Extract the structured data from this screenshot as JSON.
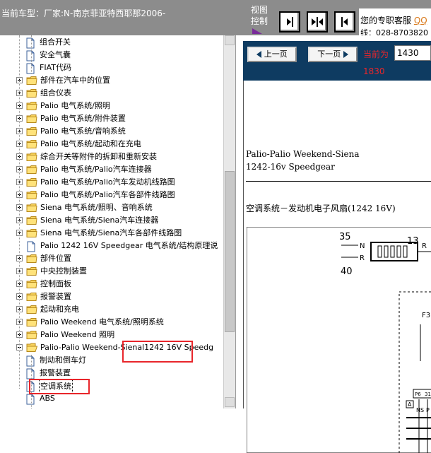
{
  "header": {
    "vehicle_label": "当前车型：厂家:N-南京菲亚特西耶那2006-",
    "view_control_label": "视图控制",
    "support": {
      "label": "您的专职客服",
      "link": "QQ",
      "phone": "线：028-8703820"
    },
    "view_buttons": [
      "collapse-left-icon",
      "split-view-icon",
      "collapse-right-icon"
    ]
  },
  "tree": {
    "items": [
      {
        "label": "组合开关",
        "type": "doc",
        "level": 1,
        "expander": "none"
      },
      {
        "label": "安全气囊",
        "type": "doc",
        "level": 1,
        "expander": "none"
      },
      {
        "label": "FIAT代码",
        "type": "doc",
        "level": 1,
        "expander": "none"
      },
      {
        "label": "部件在汽车中的位置",
        "type": "folder",
        "level": 0,
        "expander": "plus"
      },
      {
        "label": "组合仪表",
        "type": "folder",
        "level": 0,
        "expander": "plus"
      },
      {
        "label": "Palio 电气系统/照明",
        "type": "folder",
        "level": 0,
        "expander": "plus"
      },
      {
        "label": "Palio 电气系统/附件装置",
        "type": "folder",
        "level": 0,
        "expander": "plus"
      },
      {
        "label": "Palio 电气系统/音响系统",
        "type": "folder",
        "level": 0,
        "expander": "plus"
      },
      {
        "label": "Palio 电气系统/起动和在充电",
        "type": "folder",
        "level": 0,
        "expander": "plus"
      },
      {
        "label": "综合开关等附件的拆卸和重新安装",
        "type": "folder",
        "level": 0,
        "expander": "plus"
      },
      {
        "label": "Palio 电气系统/Palio汽车连接器",
        "type": "folder",
        "level": 0,
        "expander": "plus"
      },
      {
        "label": "Palio 电气系统/Palio汽车发动机线路图",
        "type": "folder",
        "level": 0,
        "expander": "plus"
      },
      {
        "label": "Palio 电气系统/Palio汽车各部件线路图",
        "type": "folder",
        "level": 0,
        "expander": "plus"
      },
      {
        "label": "Siena 电气系统/照明、音响系统",
        "type": "folder",
        "level": 0,
        "expander": "plus"
      },
      {
        "label": "Siena 电气系统/Siena汽车连接器",
        "type": "folder",
        "level": 0,
        "expander": "plus"
      },
      {
        "label": "Siena 电气系统/Siena汽车各部件线路图",
        "type": "folder",
        "level": 0,
        "expander": "plus"
      },
      {
        "label": "Palio 1242 16V Speedgear 电气系统/结构原理说",
        "type": "doc",
        "level": 0,
        "expander": "none"
      },
      {
        "label": "部件位置",
        "type": "folder",
        "level": 0,
        "expander": "plus"
      },
      {
        "label": "中央控制装置",
        "type": "folder",
        "level": 0,
        "expander": "plus"
      },
      {
        "label": "控制面板",
        "type": "folder",
        "level": 0,
        "expander": "plus"
      },
      {
        "label": "报警装置",
        "type": "folder",
        "level": 0,
        "expander": "plus"
      },
      {
        "label": "起动和充电",
        "type": "folder",
        "level": 0,
        "expander": "plus"
      },
      {
        "label": "Palio Weekend 电气系统/照明系统",
        "type": "folder",
        "level": 0,
        "expander": "plus"
      },
      {
        "label": "Palio Weekend 照明",
        "type": "folder",
        "level": 0,
        "expander": "plus"
      },
      {
        "label": "Palio-Palio Weekend-Sienal1242 16V Speedg",
        "type": "folder-open",
        "level": 0,
        "expander": "minus"
      },
      {
        "label": "制动和倒车灯",
        "type": "doc",
        "level": 1,
        "expander": "none"
      },
      {
        "label": "报警装置",
        "type": "doc",
        "level": 1,
        "expander": "none"
      },
      {
        "label": "空调系统",
        "type": "doc",
        "level": 1,
        "expander": "none",
        "selected": true
      },
      {
        "label": "ABS",
        "type": "doc",
        "level": 1,
        "expander": "none"
      }
    ]
  },
  "viewer": {
    "prev_label": "上一页",
    "next_label": "下一页",
    "current_label": "当前为",
    "current_page": "1430",
    "total_pages": "1830",
    "doc_line1": "Palio-Palio Weekend-Siena",
    "doc_line2": "1242-16v Speedgear",
    "section_title": "空调系统－发动机电子风扇(1242 16V)",
    "diagram_labels": {
      "n35": "35",
      "n40": "40",
      "n13": "13",
      "pin_n": "N",
      "pin_r": "R",
      "f3": "F3",
      "p6": "P6",
      "p31": "31",
      "a": "A",
      "ns": "NS",
      "p": "P"
    }
  },
  "colors": {
    "topbar": "#8c8c8c",
    "nav_bg": "#0e3b61",
    "highlight": "#e8262b",
    "page_text": "#e8262b"
  }
}
